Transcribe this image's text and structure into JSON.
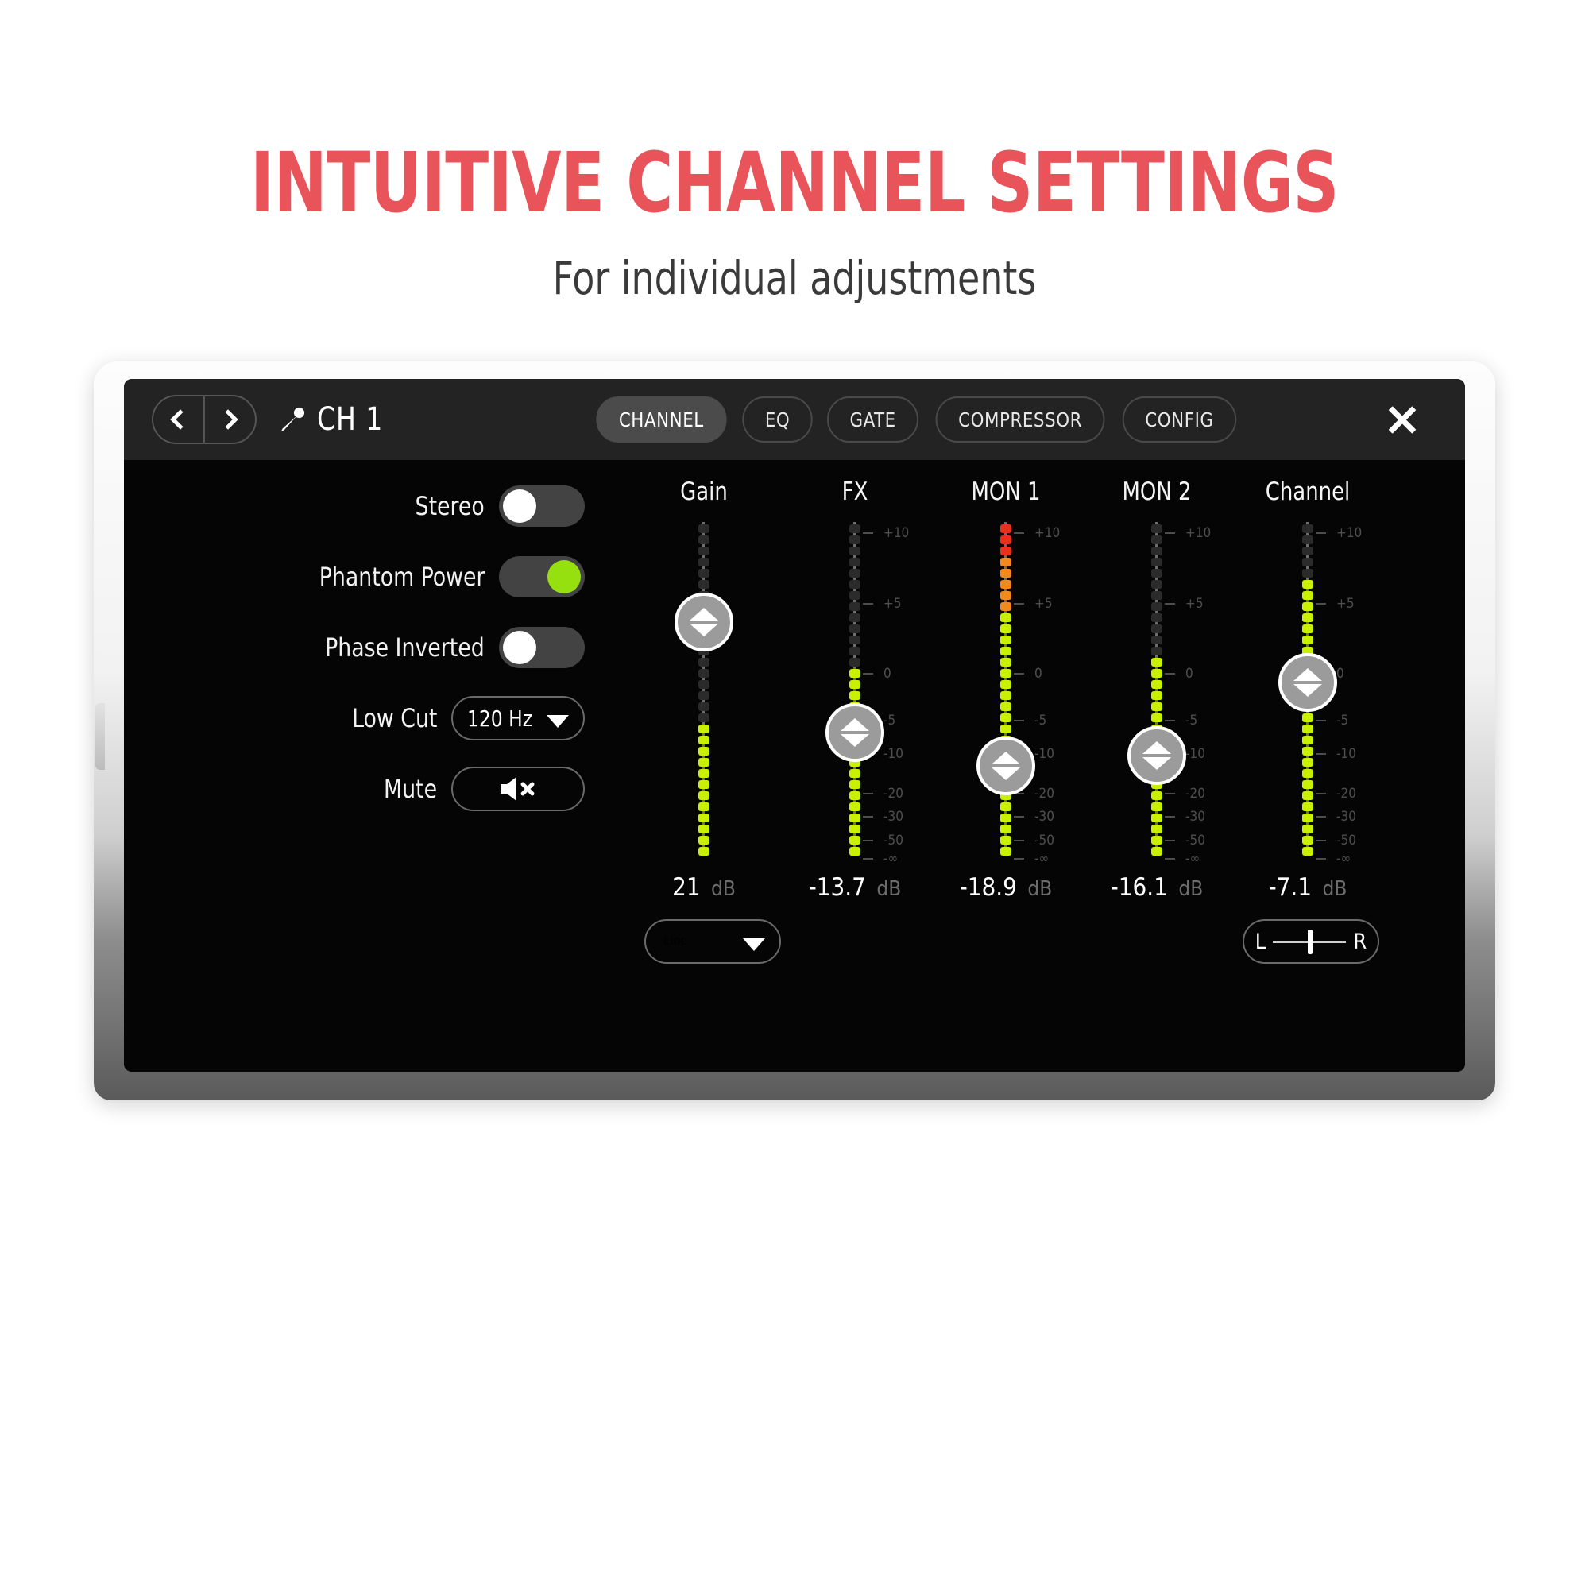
{
  "headline": {
    "title": "INTUITIVE CHANNEL SETTINGS",
    "subtitle": "For individual adjustments",
    "title_color": "#e8545a",
    "subtitle_color": "#3a3a3a"
  },
  "appbar": {
    "prev_icon": "chevron-left-icon",
    "next_icon": "chevron-right-icon",
    "channel_icon": "microphone-icon",
    "channel_label": "CH 1",
    "close_icon": "close-icon",
    "tabs": [
      {
        "label": "CHANNEL",
        "active": true
      },
      {
        "label": "EQ",
        "active": false
      },
      {
        "label": "GATE",
        "active": false
      },
      {
        "label": "COMPRESSOR",
        "active": false
      },
      {
        "label": "CONFIG",
        "active": false
      }
    ]
  },
  "left_panel": {
    "rows": [
      {
        "label": "Stereo",
        "type": "toggle",
        "value": "off"
      },
      {
        "label": "Phantom Power",
        "type": "toggle",
        "value": "on"
      },
      {
        "label": "Phase Inverted",
        "type": "toggle",
        "value": "off"
      }
    ],
    "low_cut": {
      "label": "Low Cut",
      "value": "120 Hz",
      "icon": "caret-down-icon"
    },
    "mute": {
      "label": "Mute",
      "icon": "speaker-muted-icon",
      "state": "unmuted"
    }
  },
  "meter_scale": {
    "labels": [
      "+10",
      "+5",
      "0",
      "-5",
      "-10",
      "-20",
      "-30",
      "-50",
      "-∞"
    ],
    "positions_pct": [
      2,
      23,
      44,
      58,
      68,
      80,
      87,
      94,
      99.5
    ]
  },
  "strips": [
    {
      "name": "Gain",
      "value": "21",
      "unit": "dB",
      "handle_pct": 30,
      "active_green": 12,
      "active_amber": 0,
      "active_red": 0,
      "show_scale": false,
      "bottom_control": {
        "kind": "dropdown",
        "value": "Line",
        "icon": "caret-down-icon"
      }
    },
    {
      "name": "FX",
      "value": "-13.7",
      "unit": "dB",
      "handle_pct": 63,
      "active_green": 17,
      "active_amber": 0,
      "active_red": 0,
      "show_scale": true,
      "bottom_control": null
    },
    {
      "name": "MON 1",
      "value": "-18.9",
      "unit": "dB",
      "handle_pct": 73,
      "active_green": 22,
      "active_amber": 5,
      "active_red": 3,
      "show_scale": true,
      "bottom_control": null
    },
    {
      "name": "MON 2",
      "value": "-16.1",
      "unit": "dB",
      "handle_pct": 70,
      "active_green": 18,
      "active_amber": 0,
      "active_red": 0,
      "show_scale": true,
      "bottom_control": null
    },
    {
      "name": "Channel",
      "value": "-7.1",
      "unit": "dB",
      "handle_pct": 48,
      "active_green": 25,
      "active_amber": 0,
      "active_red": 0,
      "show_scale": true,
      "bottom_control": {
        "kind": "pan",
        "left_label": "L",
        "right_label": "R",
        "position_pct": 50
      }
    }
  ],
  "colors": {
    "accent_green": "#c8f000",
    "toggle_on": "#96e010",
    "meter_amber": "#f08a1e",
    "meter_red": "#e8301c",
    "meter_off": "#2b2b2b"
  }
}
